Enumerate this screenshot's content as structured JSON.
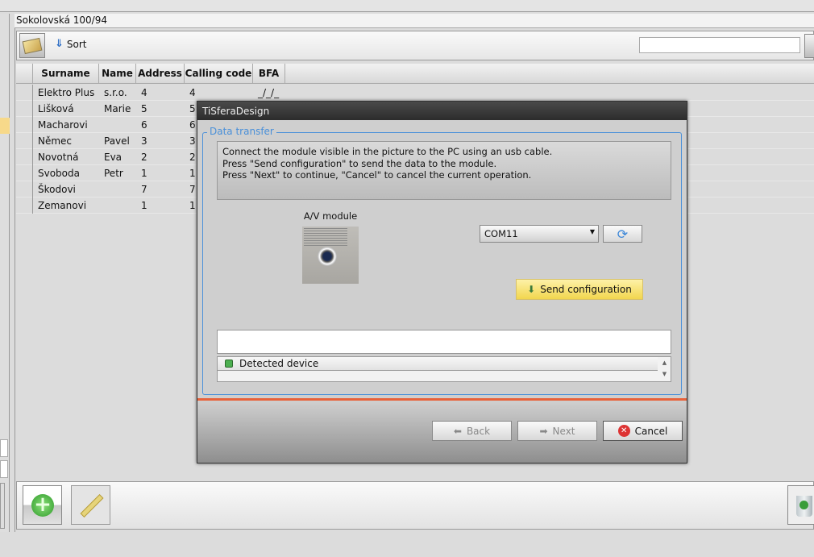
{
  "address_bar": "Sokolovská 100/94",
  "toolbar": {
    "sort_label": "Sort",
    "search_value": ""
  },
  "table": {
    "columns": [
      "Surname",
      "Name",
      "Address",
      "Calling code",
      "BFA"
    ],
    "rows": [
      [
        "Elektro Plus",
        "s.r.o.",
        "4",
        "4",
        "_/_/_"
      ],
      [
        "Lišková",
        "Marie",
        "5",
        "5",
        ""
      ],
      [
        "Macharovi",
        "",
        "6",
        "6",
        ""
      ],
      [
        "Němec",
        "Pavel",
        "3",
        "3",
        ""
      ],
      [
        "Novotná",
        "Eva",
        "2",
        "2",
        ""
      ],
      [
        "Svoboda",
        "Petr",
        "1",
        "1",
        ""
      ],
      [
        "Škodovi",
        "",
        "7",
        "7",
        ""
      ],
      [
        "Zemanovi",
        "",
        "1",
        "1",
        ""
      ]
    ]
  },
  "dialog": {
    "title": "TiSferaDesign",
    "group_title": "Data transfer",
    "info_lines": [
      "Connect the module visible in the picture to the PC using an usb cable.",
      "Press \"Send configuration\" to send the data to the module.",
      "Press \"Next\" to continue, \"Cancel\" to cancel the current operation."
    ],
    "module_label": "A/V module",
    "port_value": "COM11",
    "send_label": "Send configuration",
    "status_value": "",
    "detected_label": "Detected device",
    "back_label": "Back",
    "next_label": "Next",
    "cancel_label": "Cancel"
  },
  "colors": {
    "accent": "#4a90d9",
    "separator": "#e8623a",
    "send_button": "#f7e07a",
    "detected_led": "#4caf50"
  }
}
